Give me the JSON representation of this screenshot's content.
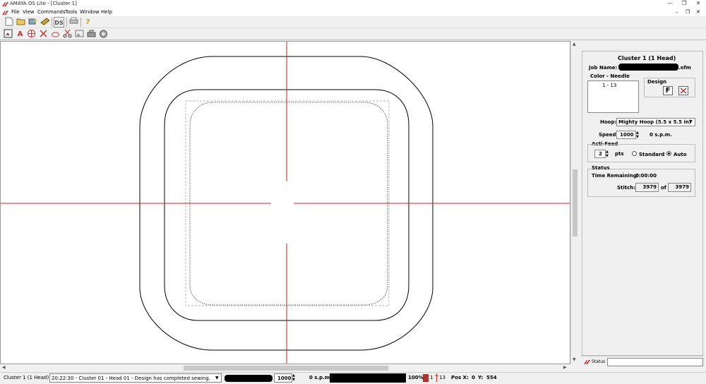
{
  "titlebar": {
    "title": "AMAYA OS Lite - [Cluster 1]",
    "minimize": "—",
    "restore": "❐",
    "close": "✕"
  },
  "menubar": {
    "items": [
      "File",
      "View",
      "Commands",
      "Tools",
      "Window",
      "Help"
    ],
    "inner_minimize": "–",
    "inner_restore": "❐",
    "inner_close": "✕"
  },
  "toolbar1": {
    "ds_label": "DS",
    "help_label": "?"
  },
  "toolbar2": {
    "text_label": "A"
  },
  "panel": {
    "heading": "Cluster 1 (1 Head)",
    "job_name_label": "Job Name:",
    "job_name_suffix": ".ofm",
    "color_needle_label": "Color - Needle",
    "color_needle_item": "1  -  13",
    "design_label": "Design",
    "design_f_button": "F",
    "hoop_label": "Hoop:",
    "hoop_value": "Mighty Hoop (5.5 x 5.5 in)",
    "speed_label": "Speed:",
    "speed_value": "1000",
    "speed_unit": "0  s.p.m.",
    "actifeed_label": "Acti-Feed",
    "actifeed_value": "2",
    "actifeed_unit": "pts",
    "standard_label": "Standard",
    "auto_label": "Auto",
    "status_label": "Status",
    "time_remaining_label": "Time Remaining:",
    "time_remaining_value": "0:00:00",
    "stitch_label": "Stitch:",
    "stitch_value": "3979",
    "stitch_of": "of",
    "stitch_total": "3979",
    "status_tab": "Status"
  },
  "statusbar": {
    "cluster": "Cluster 1 (1 Head)",
    "message": "20:22:30 - Cluster 01 - Head 01 - Design has completed sewing.",
    "speed_value": "1000",
    "speed_unit": "0  s.p.m.",
    "percent": "100%",
    "needle_count": "1",
    "needle_total": "13",
    "pos_label": "Pos X:",
    "pos_x": "0",
    "y_label": "Y:",
    "pos_y": "554"
  },
  "colors": {
    "accent": "#d32f2f",
    "crosshair": "#cc2222",
    "stop_bar": "#000000",
    "needle_swatch": "#b03030"
  }
}
